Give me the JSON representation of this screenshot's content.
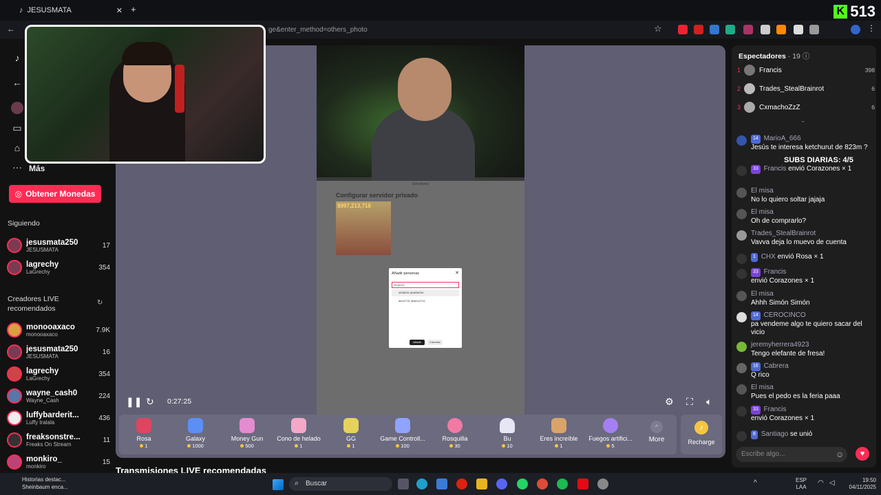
{
  "browser": {
    "tab_title": "JESUSMATA",
    "url": "ge&enter_method=others_photo",
    "kick_count": "513"
  },
  "nav": {
    "more_label": "Más",
    "coins_button": "Obtener Monedas",
    "following_label": "Siguiendo",
    "following": [
      {
        "name": "jesusmata250",
        "sub": "JESUSMATA",
        "count": "17"
      },
      {
        "name": "lagrechy",
        "sub": "LaGrechy",
        "count": "354"
      }
    ],
    "live_label": "Creadores LIVE recomendados",
    "live": [
      {
        "name": "monooaxaco",
        "sub": "monooaxaco",
        "count": "7.9K"
      },
      {
        "name": "jesusmata250",
        "sub": "JESUSMATA",
        "count": "16"
      },
      {
        "name": "lagrechy",
        "sub": "LaGrechy",
        "count": "354"
      },
      {
        "name": "wayne_cash0",
        "sub": "Wayne_Cash",
        "count": "224"
      },
      {
        "name": "luffybarderit...",
        "sub": "Luffy tralala",
        "count": "436"
      },
      {
        "name": "freaksonstre...",
        "sub": "Freaks On Stream",
        "count": "11"
      },
      {
        "name": "monkiro_",
        "sub": "monkiro",
        "count": "15"
      }
    ]
  },
  "video": {
    "time": "0:27:25",
    "sheet_label": "Servidores",
    "sheet_title": "Configurar servidor privado",
    "price": "$997,213,718",
    "dialog_title": "Añadir personas",
    "dialog_input": "4638234",
    "dialog_rows": [
      "4638234  @4638234",
      "aero2741  @aero2741"
    ],
    "dialog_add": "Añadir",
    "dialog_cancel": "Cancelar"
  },
  "gifts": [
    {
      "name": "Rosa",
      "price": "1",
      "color": "#e0455f"
    },
    {
      "name": "Galaxy",
      "price": "1000",
      "color": "#5b8ff5"
    },
    {
      "name": "Money Gun",
      "price": "500",
      "color": "#e48bd0"
    },
    {
      "name": "Cono de helado",
      "price": "1",
      "color": "#f3a8c8"
    },
    {
      "name": "GG",
      "price": "1",
      "color": "#e6d25a"
    },
    {
      "name": "Game Controll...",
      "price": "100",
      "color": "#8fa3ff"
    },
    {
      "name": "Rosquilla",
      "price": "30",
      "color": "#f07aa4"
    },
    {
      "name": "Bu",
      "price": "10",
      "color": "#e6e6f5"
    },
    {
      "name": "Eres increíble",
      "price": "1",
      "color": "#d9a46a"
    },
    {
      "name": "Fuegos artifici...",
      "price": "5",
      "color": "#a47ff2"
    }
  ],
  "more_label": "More",
  "recharge_label": "Recharge",
  "recommended_label": "Transmisiones LIVE recomendadas",
  "chat": {
    "spectators_label": "Espectadores",
    "spectators_count": "· 19",
    "top_viewers": [
      {
        "rank": "1",
        "name": "Francis",
        "score": "398"
      },
      {
        "rank": "2",
        "name": "Trades_StealBrainrot",
        "score": "6"
      },
      {
        "rank": "3",
        "name": "CxmachoZzZ",
        "score": "6"
      }
    ],
    "subs_banner": "SUBS DIARIAS: 4/5",
    "messages": [
      {
        "lvl": "14",
        "user": "MarioA_666",
        "text": "Jesús te interesa ketchurut de 823m ?"
      },
      {
        "lvl": "33",
        "user": "Francis",
        "text": "envió Corazones × 1"
      },
      {
        "lvl": "",
        "user": "El misa",
        "text": "No lo quiero soltar jajaja"
      },
      {
        "lvl": "",
        "user": "El misa",
        "text": "Oh de comprarlo?"
      },
      {
        "lvl": "",
        "user": "Trades_StealBrainrot",
        "text": "Vavva deja lo muevo de cuenta"
      },
      {
        "lvl": "1",
        "user": "CHX",
        "text": "envió Rosa × 1"
      },
      {
        "lvl": "33",
        "user": "Francis",
        "text": "envió Corazones × 1"
      },
      {
        "lvl": "",
        "user": "El misa",
        "text": "Ahhh Simón Simón"
      },
      {
        "lvl": "14",
        "user": "CEROCINCO",
        "text": "pa vendeme algo te quiero sacar del vicio"
      },
      {
        "lvl": "",
        "user": "jeremyherrera4923",
        "text": "Tengo elefante de fresa!"
      },
      {
        "lvl": "16",
        "user": "Cabrera",
        "text": "Q rico"
      },
      {
        "lvl": "",
        "user": "El misa",
        "text": "Pues el pedo es la feria paaa"
      },
      {
        "lvl": "33",
        "user": "Francis",
        "text": "envió Corazones × 1"
      },
      {
        "lvl": "8",
        "user": "Santiago",
        "text": "se unió"
      }
    ],
    "input_placeholder": "Escribe algo..."
  },
  "taskbar": {
    "news_title": "Historias destac...",
    "news_sub": "Sheinbaum enca...",
    "search": "Buscar",
    "lang1": "ESP",
    "lang2": "LAA",
    "time": "19:50",
    "date": "04/11/2025"
  }
}
